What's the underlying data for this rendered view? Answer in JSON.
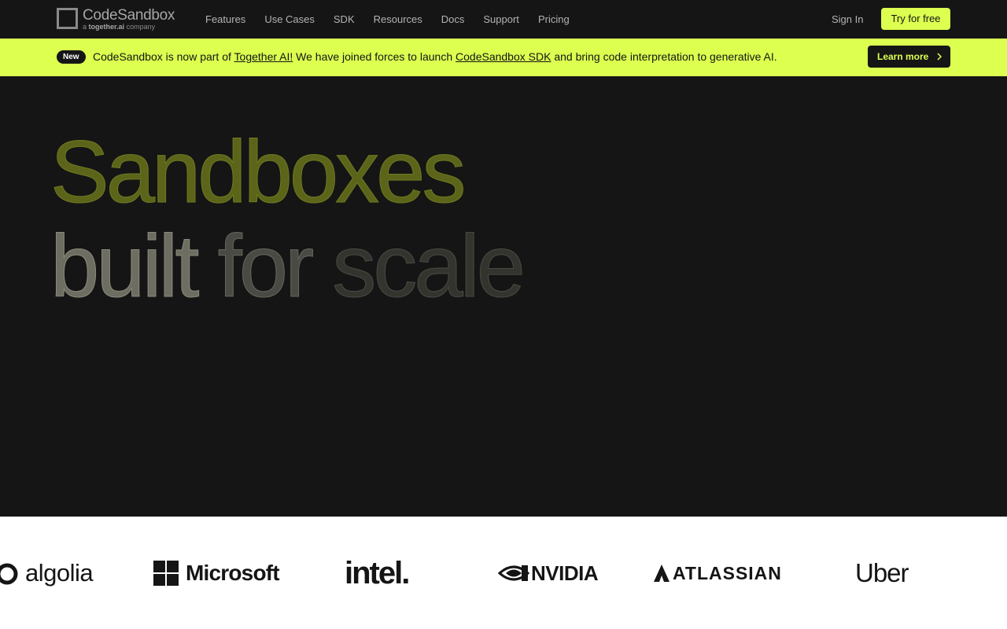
{
  "nav": {
    "logo_name": "CodeSandbox",
    "logo_sub_prefix": "a",
    "logo_sub_brand": "together.ai",
    "logo_sub_suffix": "company",
    "links": [
      "Features",
      "Use Cases",
      "SDK",
      "Resources",
      "Docs",
      "Support",
      "Pricing"
    ],
    "sign_in": "Sign In",
    "cta": "Try for free"
  },
  "banner": {
    "badge": "New",
    "text_1": "CodeSandbox is now part of ",
    "link_1": "Together AI!",
    "text_2": " We have joined forces to launch ",
    "link_2": "CodeSandbox SDK",
    "text_3": " and bring code interpretation to generative AI.",
    "button": "Learn more"
  },
  "hero": {
    "line_1": "Sandboxes",
    "word_built": "built",
    "word_for": "for",
    "word_scale": "scale"
  },
  "logos": {
    "algolia": "algolia",
    "microsoft": "Microsoft",
    "intel": "intel.",
    "nvidia": "NVIDIA",
    "atlassian": "ATLASSIAN",
    "uber": "Uber"
  },
  "colors": {
    "background": "#151515",
    "accent": "#dcff50",
    "logo_strip": "#ffffff"
  }
}
